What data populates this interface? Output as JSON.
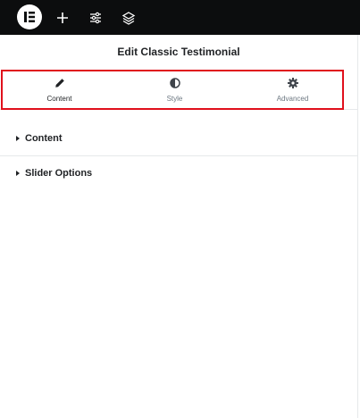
{
  "panel": {
    "title": "Edit Classic Testimonial"
  },
  "toolbar": {
    "icons": [
      "elementor-logo-icon",
      "add-icon",
      "sliders-icon",
      "layers-icon"
    ]
  },
  "tabs": [
    {
      "label": "Content",
      "icon": "pencil-icon",
      "active": true
    },
    {
      "label": "Style",
      "icon": "half-circle-icon",
      "active": false
    },
    {
      "label": "Advanced",
      "icon": "gear-icon",
      "active": false
    }
  ],
  "sections": [
    {
      "label": "Content"
    },
    {
      "label": "Slider Options"
    }
  ],
  "colors": {
    "topbar": "#0c0d0e",
    "highlight": "#e0101c",
    "text": "#1f2124",
    "muted": "#6d7882"
  }
}
